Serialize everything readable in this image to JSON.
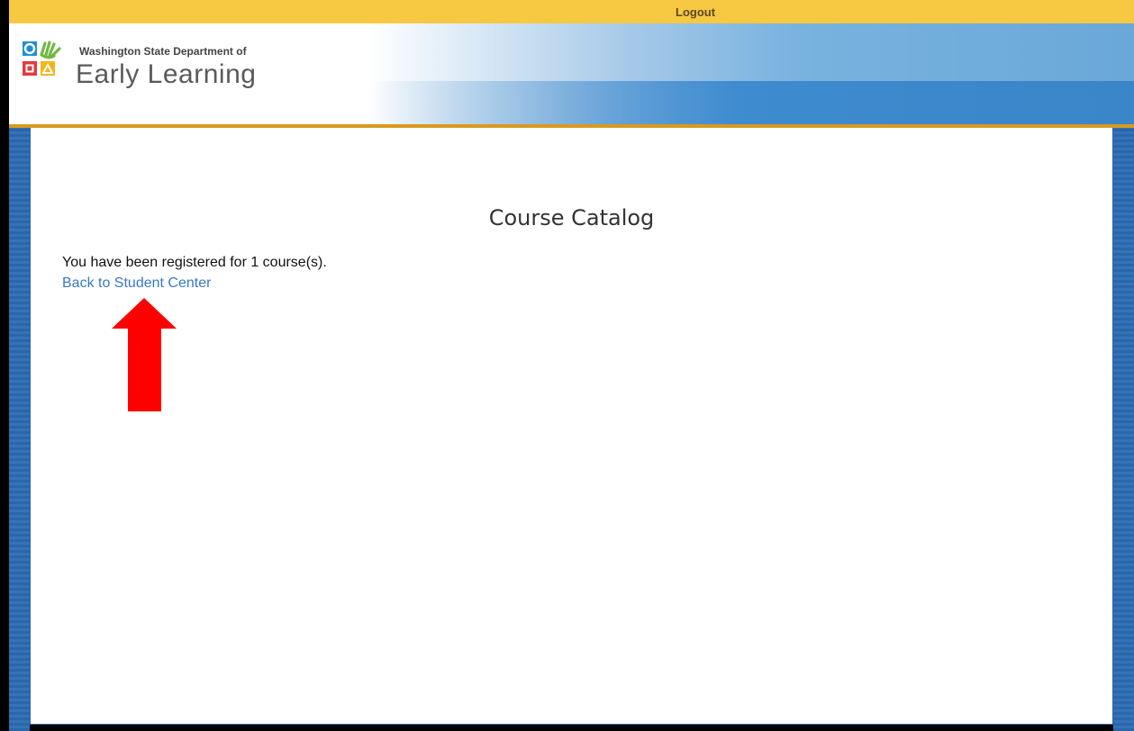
{
  "topbar": {
    "logout_label": "Logout"
  },
  "header": {
    "logo_line1": "Washington State Department of",
    "logo_line2": "Early Learning"
  },
  "main": {
    "title": "Course Catalog",
    "message": "You have been registered for 1 course(s).",
    "back_link": "Back to Student Center"
  },
  "annotation": {
    "arrow_color": "#ff0000",
    "icon": "up-arrow-icon"
  },
  "colors": {
    "topbar": "#f7c842",
    "header_line": "#d99a1f",
    "link": "#3a78c2",
    "frame_blue": "#2b66a8"
  }
}
